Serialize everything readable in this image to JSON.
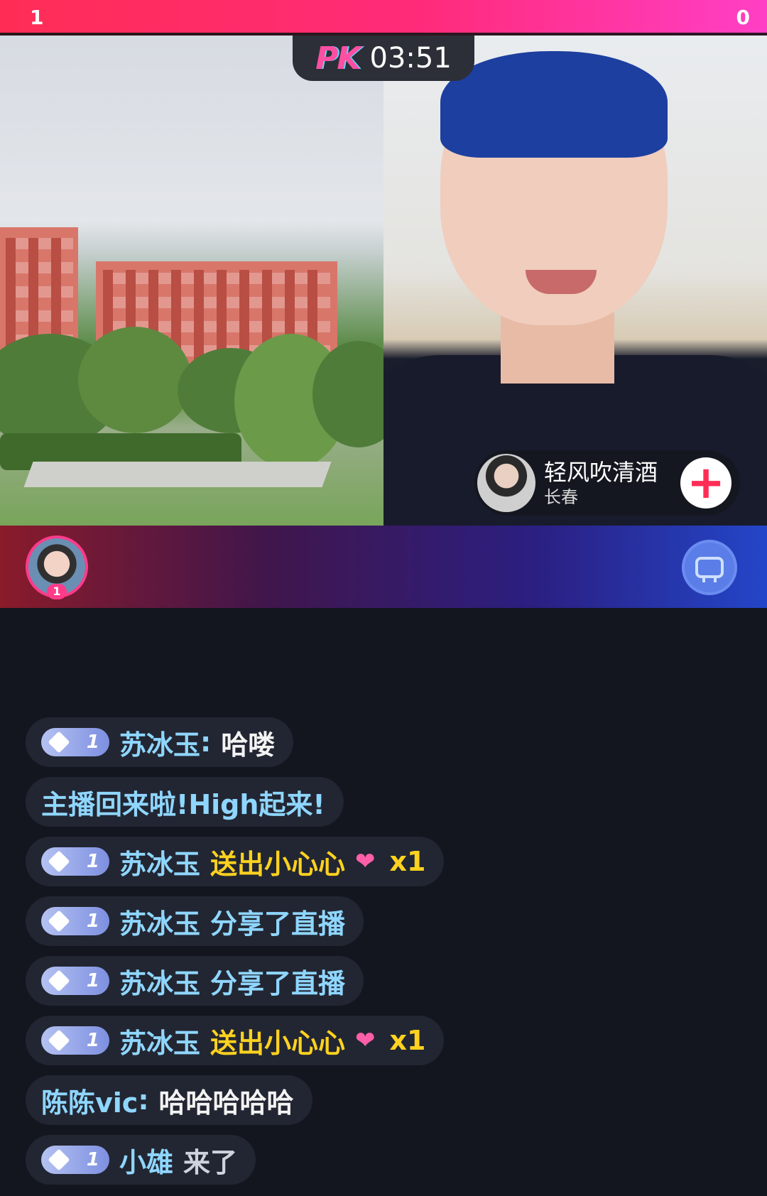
{
  "pk_bar": {
    "left_score": "1",
    "right_score": "0",
    "timer": "03:51",
    "logo": "PK"
  },
  "opponent": {
    "name": "轻风吹清酒",
    "city": "长春",
    "follow_label": "+"
  },
  "contributors": {
    "top_rank": "1"
  },
  "chat": {
    "messages": [
      {
        "badge": "1",
        "user": "苏冰玉",
        "sep": ":",
        "text": "哈喽",
        "kind": "chat"
      },
      {
        "text": "主播回来啦!High起来!",
        "kind": "system"
      },
      {
        "badge": "1",
        "user": "苏冰玉",
        "text": "送出小心心",
        "gift_icon": "heart-icon",
        "count": "x1",
        "kind": "gift"
      },
      {
        "badge": "1",
        "user": "苏冰玉",
        "text": "分享了直播",
        "kind": "share"
      },
      {
        "badge": "1",
        "user": "苏冰玉",
        "text": "分享了直播",
        "kind": "share"
      },
      {
        "badge": "1",
        "user": "苏冰玉",
        "text": "送出小心心",
        "gift_icon": "heart-icon",
        "count": "x1",
        "kind": "gift"
      },
      {
        "user": "陈陈vic",
        "sep": ":",
        "text": "哈哈哈哈哈",
        "kind": "chat"
      },
      {
        "badge": "1",
        "user": "小雄",
        "text": "来了",
        "kind": "join"
      }
    ]
  },
  "colors": {
    "score_bar": "#ff2d55",
    "username": "#8fd6ff",
    "gift": "#ffd21f",
    "follow": "#ff2d55"
  }
}
